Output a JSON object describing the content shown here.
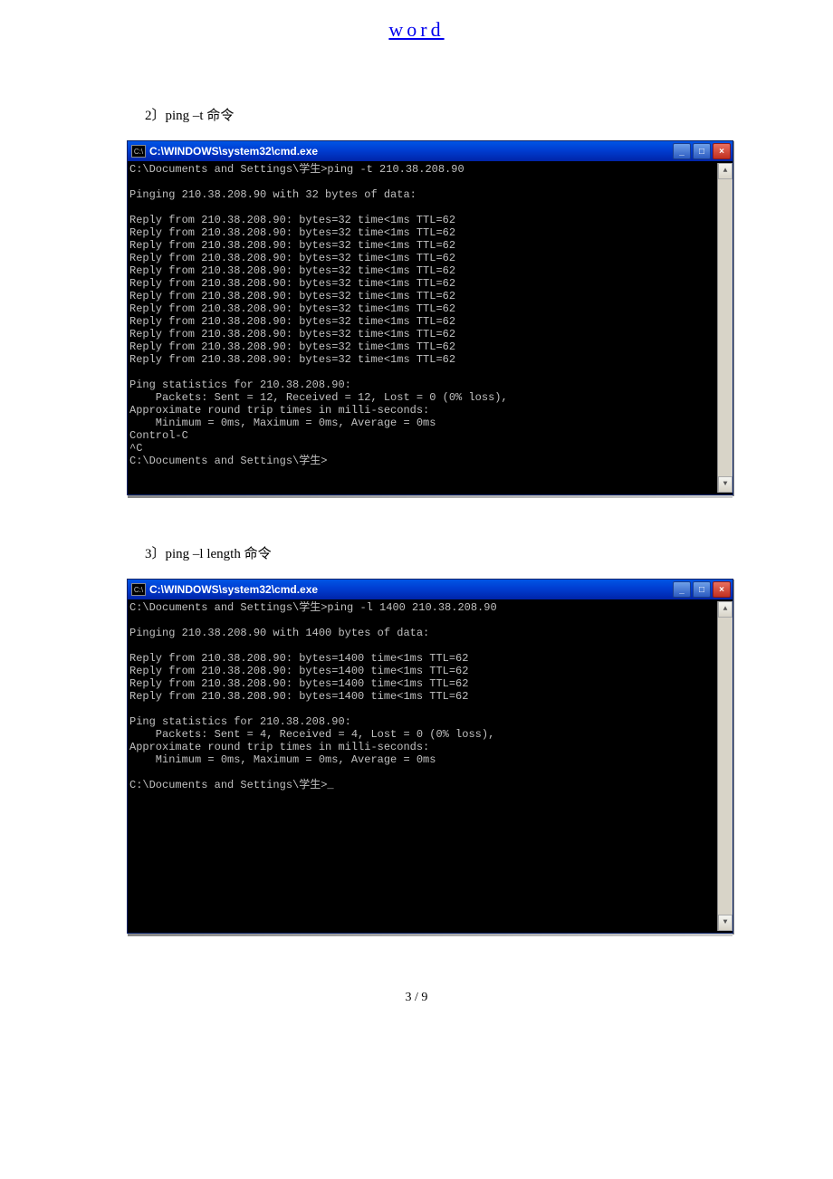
{
  "header": {
    "link_text": "word"
  },
  "captions": {
    "c1": "2〕ping –t   命令",
    "c2": "3〕ping –l length 命令"
  },
  "cmd_icon_label": "C:\\",
  "window1": {
    "title": "C:\\WINDOWS\\system32\\cmd.exe",
    "content": "C:\\Documents and Settings\\学生>ping -t 210.38.208.90\n\nPinging 210.38.208.90 with 32 bytes of data:\n\nReply from 210.38.208.90: bytes=32 time<1ms TTL=62\nReply from 210.38.208.90: bytes=32 time<1ms TTL=62\nReply from 210.38.208.90: bytes=32 time<1ms TTL=62\nReply from 210.38.208.90: bytes=32 time<1ms TTL=62\nReply from 210.38.208.90: bytes=32 time<1ms TTL=62\nReply from 210.38.208.90: bytes=32 time<1ms TTL=62\nReply from 210.38.208.90: bytes=32 time<1ms TTL=62\nReply from 210.38.208.90: bytes=32 time<1ms TTL=62\nReply from 210.38.208.90: bytes=32 time<1ms TTL=62\nReply from 210.38.208.90: bytes=32 time<1ms TTL=62\nReply from 210.38.208.90: bytes=32 time<1ms TTL=62\nReply from 210.38.208.90: bytes=32 time<1ms TTL=62\n\nPing statistics for 210.38.208.90:\n    Packets: Sent = 12, Received = 12, Lost = 0 (0% loss),\nApproximate round trip times in milli-seconds:\n    Minimum = 0ms, Maximum = 0ms, Average = 0ms\nControl-C\n^C\nC:\\Documents and Settings\\学生>\n\n\n"
  },
  "window2": {
    "title": "C:\\WINDOWS\\system32\\cmd.exe",
    "content": "C:\\Documents and Settings\\学生>ping -l 1400 210.38.208.90\n\nPinging 210.38.208.90 with 1400 bytes of data:\n\nReply from 210.38.208.90: bytes=1400 time<1ms TTL=62\nReply from 210.38.208.90: bytes=1400 time<1ms TTL=62\nReply from 210.38.208.90: bytes=1400 time<1ms TTL=62\nReply from 210.38.208.90: bytes=1400 time<1ms TTL=62\n\nPing statistics for 210.38.208.90:\n    Packets: Sent = 4, Received = 4, Lost = 0 (0% loss),\nApproximate round trip times in milli-seconds:\n    Minimum = 0ms, Maximum = 0ms, Average = 0ms\n\nC:\\Documents and Settings\\学生>_\n\n\n\n\n\n\n\n\n\n\n\n"
  },
  "footer": {
    "text": "3 / 9"
  }
}
